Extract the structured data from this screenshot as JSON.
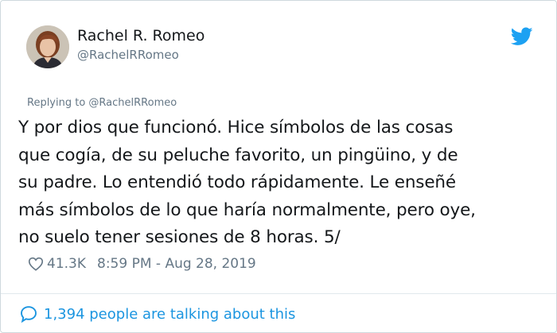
{
  "author": {
    "name": "Rachel R. Romeo",
    "handle": "@RachelRRomeo"
  },
  "reply_context": "Replying to @RachelRRomeo",
  "tweet_lines": [
    "Y por dios que funcionó. Hice símbolos de las cosas",
    "que cogía, de su peluche favorito, un pingüino, y de",
    "su padre. Lo entendió todo rápidamente. Le enseñé",
    "más símbolos de lo que haría normalmente, pero oye,",
    "no suelo tener sesiones de 8 horas. 5/"
  ],
  "meta": {
    "likes": "41.3K",
    "timestamp": "8:59 PM - Aug 28, 2019"
  },
  "conversation_link": "1,394 people are talking about this",
  "icons": {
    "brand": "twitter-bird-icon",
    "like": "heart-icon",
    "conversation": "speech-bubble-icon"
  },
  "colors": {
    "text": "#14171a",
    "secondary": "#657786",
    "link": "#1b95e0",
    "twitter_blue": "#1da1f2"
  }
}
